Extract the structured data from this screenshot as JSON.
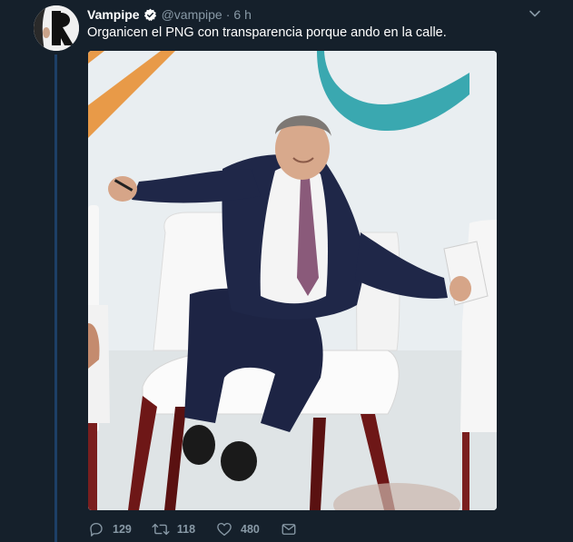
{
  "tweet": {
    "author": {
      "display_name": "Vampipe",
      "handle": "@vampipe",
      "verified": true
    },
    "separator": "·",
    "time": "6 h",
    "text": "Organicen el PNG con transparencia porque ando en la calle.",
    "media_icon": "photo",
    "actions": {
      "reply": {
        "icon": "reply-icon",
        "count": "129"
      },
      "retweet": {
        "icon": "retweet-icon",
        "count": "118"
      },
      "like": {
        "icon": "heart-icon",
        "count": "480"
      },
      "dm": {
        "icon": "envelope-icon"
      }
    }
  },
  "colors": {
    "background": "#15202b",
    "thread_line": "#1d3f66",
    "muted_text": "#8899a6",
    "verified": "#1da1f2"
  }
}
